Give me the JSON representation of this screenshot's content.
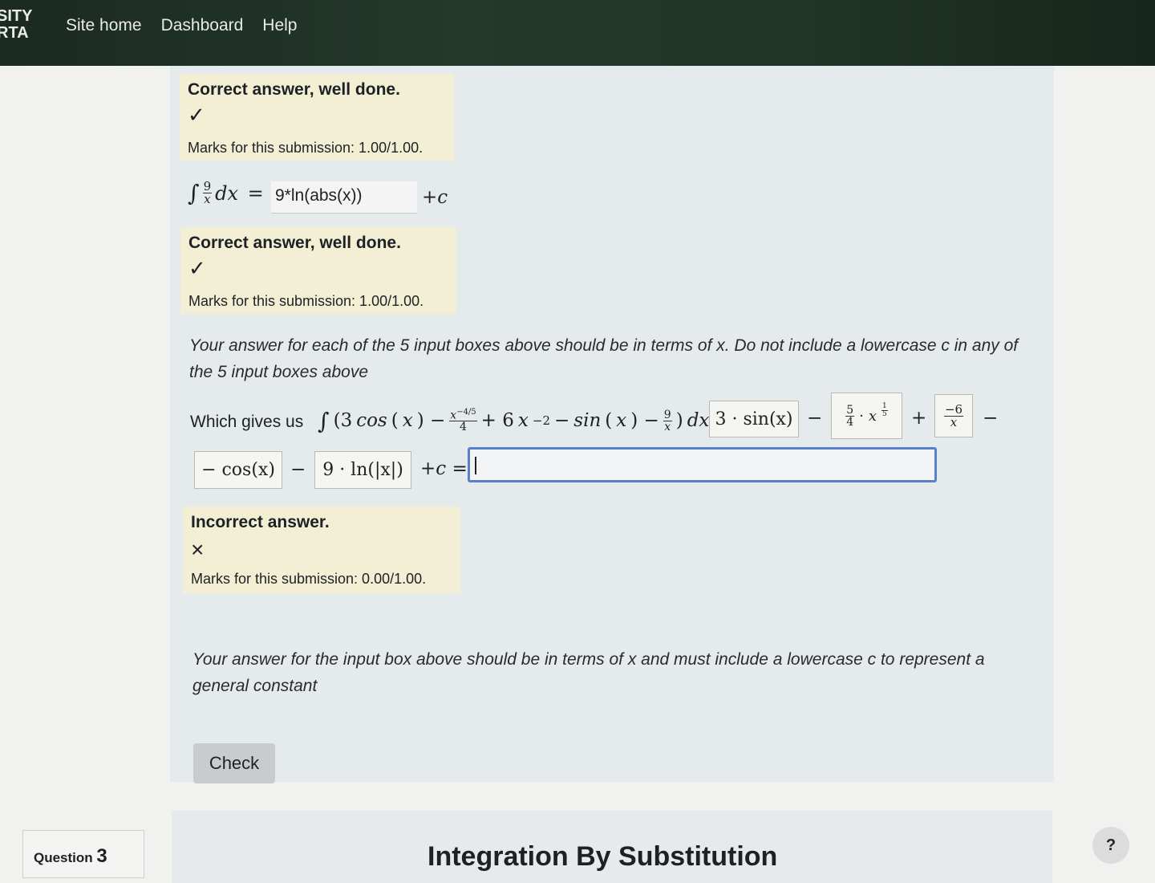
{
  "header": {
    "brand_line1": "SITY",
    "brand_line2": "RTA",
    "nav": [
      "Site home",
      "Dashboard",
      "Help"
    ]
  },
  "feedback": [
    {
      "title": "Correct answer, well done.",
      "symbol": "✓",
      "marks": "Marks for this submission: 1.00/1.00."
    },
    {
      "title": "Correct answer, well done.",
      "symbol": "✓",
      "marks": "Marks for this submission: 1.00/1.00."
    },
    {
      "title": "Incorrect answer.",
      "symbol": "×",
      "marks": "Marks for this submission: 0.00/1.00."
    }
  ],
  "integral1": {
    "answer_value": "9*ln(abs(x))",
    "plus_c": "+c"
  },
  "notes": {
    "five_boxes": "Your answer for each of the 5 input boxes above should be in terms of x. Do not include a lowercase c in any of the 5 input boxes above",
    "final_box": "Your answer for the input box above should be in terms of x and must include a lowercase c to represent a general constant"
  },
  "which_gives": {
    "prefix": "Which gives us",
    "box1": "3 · sin(x)",
    "box4": "− cos(x)",
    "box5": "9 · ln(|x|)",
    "tail": "+c ="
  },
  "final_answer_value": "",
  "check_label": "Check",
  "question": {
    "label": "Question",
    "number": "3"
  },
  "section_title": "Integration By Substitution",
  "help_label": "?"
}
